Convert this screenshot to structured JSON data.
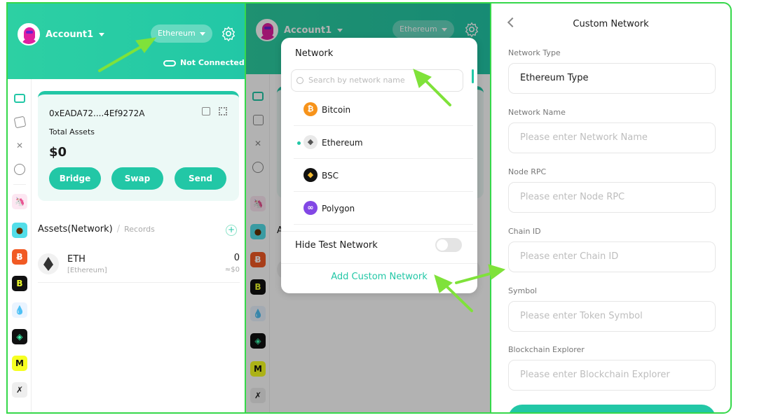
{
  "wallet": {
    "account_name": "Account1",
    "network_selected": "Ethereum",
    "connection_status": "Not Connected",
    "address": "0xEADA72....4Ef9272A",
    "total_assets_label": "Total Assets",
    "total_assets_value": "$0",
    "buttons": {
      "bridge": "Bridge",
      "swap": "Swap",
      "send": "Send"
    },
    "assets_title": "Assets(Network)",
    "records_label": "Records",
    "assets": [
      {
        "symbol": "ETH",
        "network": "[Ethereum]",
        "amount": "0",
        "value": "≈$0"
      }
    ]
  },
  "network_dropdown": {
    "title": "Network",
    "search_placeholder": "Search by network name",
    "networks": [
      {
        "name": "Bitcoin",
        "icon": "bitcoin-icon",
        "color": "#f7931a"
      },
      {
        "name": "Ethereum",
        "icon": "ethereum-icon",
        "color": "#e9e9e9"
      },
      {
        "name": "BSC",
        "icon": "bsc-icon",
        "color": "#111111"
      },
      {
        "name": "Polygon",
        "icon": "polygon-icon",
        "color": "#8247e5"
      }
    ],
    "hide_test_network_label": "Hide Test Network",
    "add_custom_network_label": "Add Custom Network"
  },
  "custom_network": {
    "title": "Custom Network",
    "fields": [
      {
        "label": "Network Type",
        "value": "Ethereum Type",
        "placeholder": ""
      },
      {
        "label": "Network Name",
        "value": "",
        "placeholder": "Please enter Network Name"
      },
      {
        "label": "Node RPC",
        "value": "",
        "placeholder": "Please enter Node RPC"
      },
      {
        "label": "Chain ID",
        "value": "",
        "placeholder": "Please enter Chain ID"
      },
      {
        "label": "Symbol",
        "value": "",
        "placeholder": "Please enter Token Symbol"
      },
      {
        "label": "Blockchain Explorer",
        "value": "",
        "placeholder": "Please enter Blockchain Explorer"
      }
    ]
  },
  "colors": {
    "accent": "#22c7a6",
    "highlight_border": "#35d84a",
    "arrow": "#7fe23a"
  }
}
